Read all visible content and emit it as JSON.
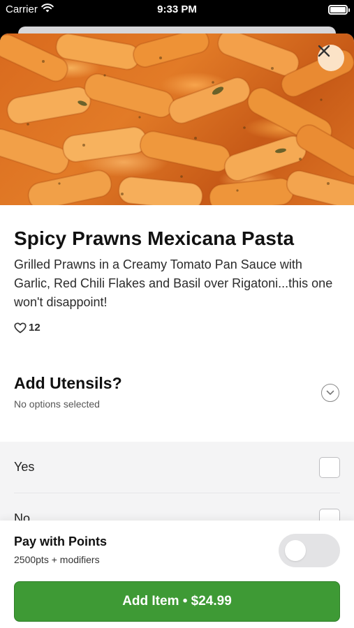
{
  "status_bar": {
    "carrier": "Carrier",
    "time": "9:33 PM",
    "icons": [
      "wifi-icon",
      "battery-icon"
    ]
  },
  "item": {
    "image_alt_icon": "pasta-photo",
    "title": "Spicy Prawns Mexicana Pasta",
    "description": "Grilled Prawns in a Creamy Tomato Pan Sauce with Garlic, Red Chili Flakes and Basil over Rigatoni...this one won't disappoint!",
    "likes": "12",
    "close_icon": "close-icon"
  },
  "utensils": {
    "title": "Add Utensils?",
    "subtitle": "No options selected",
    "options": [
      {
        "label": "Yes",
        "checked": false
      },
      {
        "label": "No",
        "checked": false
      }
    ]
  },
  "points": {
    "title": "Pay with Points",
    "subtitle": "2500pts + modifiers",
    "enabled": false
  },
  "add_button": {
    "label": "Add Item • $24.99"
  },
  "colors": {
    "accent_green": "#3e9a35",
    "close_bg": "#fbe3c7",
    "options_bg": "#f4f4f5"
  }
}
